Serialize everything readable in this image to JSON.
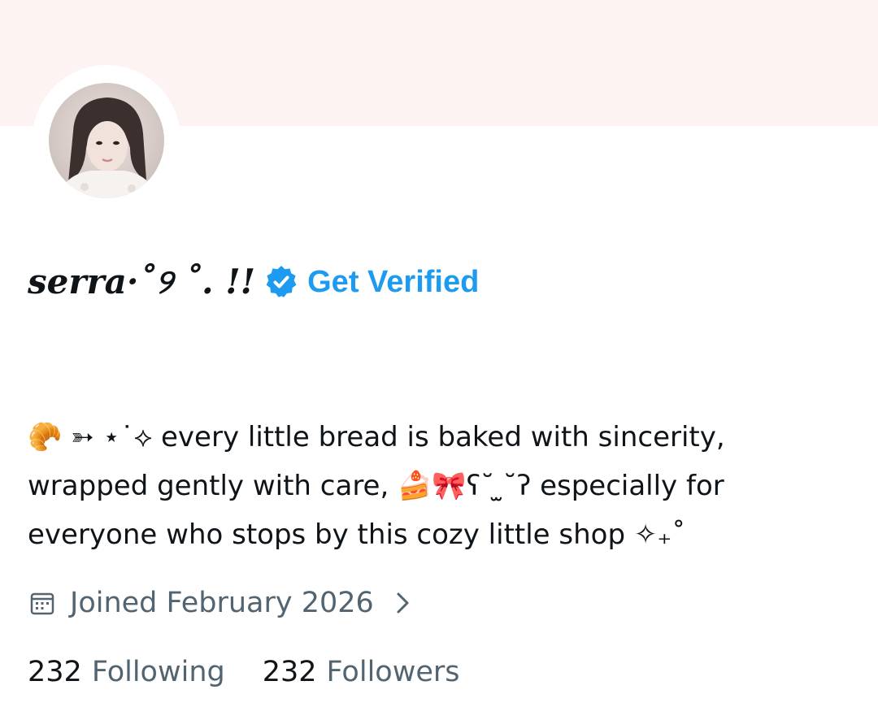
{
  "profile": {
    "display_name": "serra·˚୨ ˚. !!",
    "get_verified_label": "Get Verified",
    "bio_lines": [
      "🥐 ➳ ⋆˙⟡ every little bread is baked with sincerity,",
      "wrapped gently with care, 🍰🎀ʕ˘ ̫˘ʔ especially for",
      "everyone who stops by this cozy little shop ✧₊˚"
    ],
    "joined_text": "Joined February 2026",
    "following_count": "232",
    "following_label": "Following",
    "followers_count": "232",
    "followers_label": "Followers"
  },
  "icons": {
    "verified": "verified-badge-icon",
    "calendar": "calendar-icon",
    "chevron": "chevron-right-icon"
  },
  "colors": {
    "accent": "#1d9bf0",
    "banner": "#fdf3f3",
    "secondary_text": "#536471",
    "primary_text": "#0f1419"
  }
}
